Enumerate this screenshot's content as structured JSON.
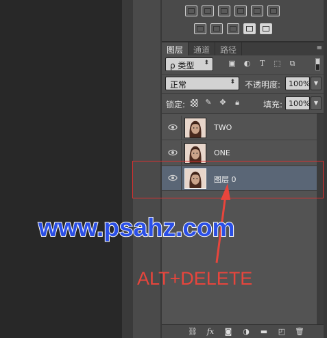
{
  "tabs": [
    "图层",
    "通道",
    "路径"
  ],
  "tab_menu": "≡",
  "filter": {
    "kind_label": "ρ 类型",
    "icons": [
      "image-filter-icon",
      "adjustment-filter-icon",
      "type-filter-icon",
      "shape-filter-icon",
      "smart-object-filter-icon"
    ]
  },
  "blend": {
    "mode": "正常",
    "opacity_label": "不透明度:",
    "opacity_value": "100%"
  },
  "lock": {
    "label": "锁定:",
    "fill_label": "填充:",
    "fill_value": "100%"
  },
  "layers": [
    {
      "name": "TWO",
      "selected": false
    },
    {
      "name": "ONE",
      "selected": false
    },
    {
      "name": "图层 0",
      "selected": true
    }
  ],
  "watermark": "www.psahz.com",
  "annotation": "ALT+DELETE",
  "colors": {
    "highlight": "#e03030",
    "annotation": "#e8453c",
    "watermark": "#2b4fe6",
    "selected_layer": "#5a6676"
  }
}
